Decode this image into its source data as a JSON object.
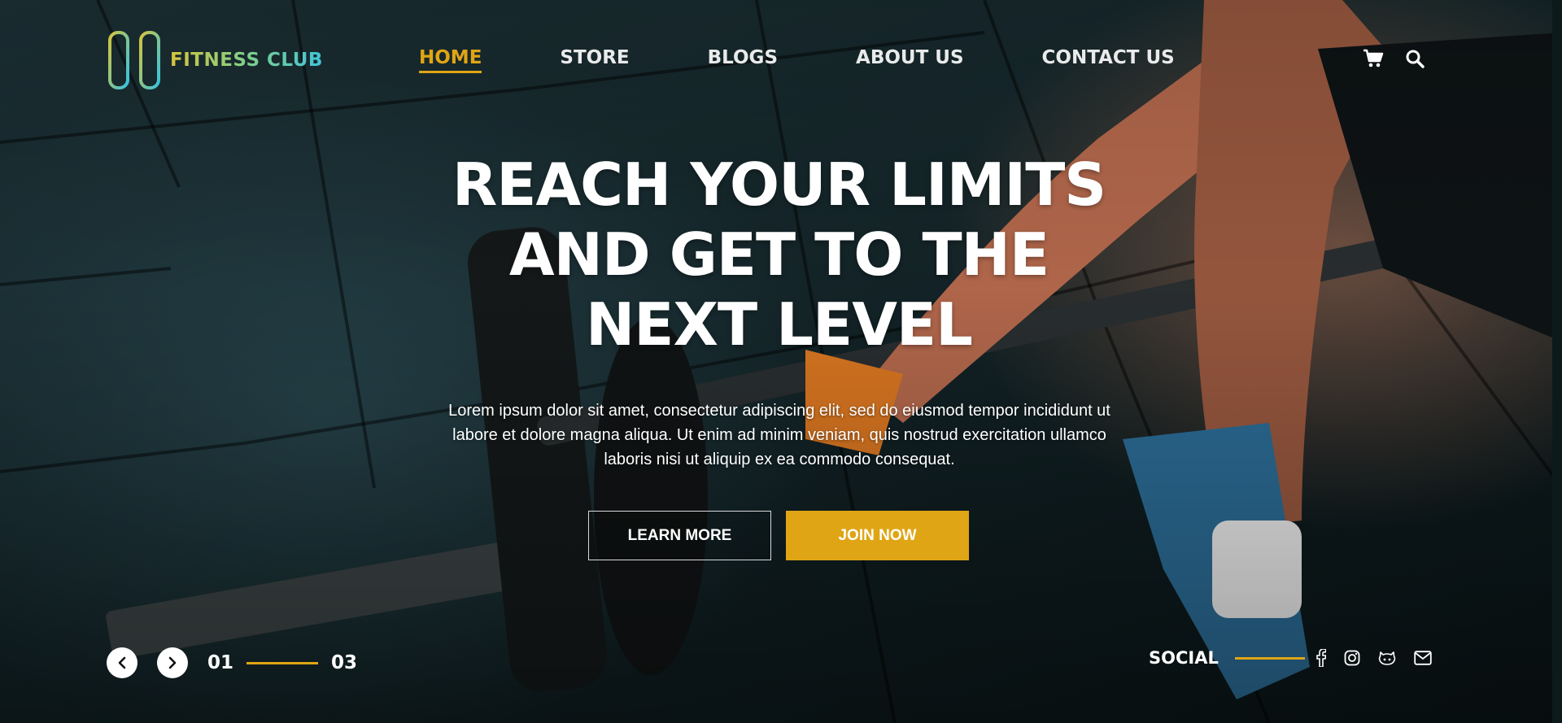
{
  "brand": {
    "name": "FITNESS CLUB"
  },
  "nav": {
    "items": [
      {
        "label": "HOME",
        "active": true
      },
      {
        "label": "STORE",
        "active": false
      },
      {
        "label": "BLOGS",
        "active": false
      },
      {
        "label": "ABOUT US",
        "active": false
      },
      {
        "label": "CONTACT US",
        "active": false
      }
    ],
    "icons": [
      "cart-icon",
      "search-icon"
    ]
  },
  "hero": {
    "headline_lines": [
      "REACH YOUR LIMITS",
      "AND GET TO THE",
      "NEXT LEVEL"
    ],
    "lead_lines": [
      "Lorem ipsum dolor sit amet, consectetur adipiscing elit, sed do eiusmod tempor incididunt ut",
      "labore et dolore magna aliqua. Ut enim ad minim veniam, quis nostrud exercitation ullamco",
      "laboris nisi ut aliquip ex ea commodo consequat."
    ],
    "learn_more_label": "LEARN MORE",
    "join_now_label": "JOIN NOW"
  },
  "slider": {
    "current": "01",
    "total": "03",
    "prev_icon": "chevron-left-icon",
    "next_icon": "chevron-right-icon"
  },
  "social": {
    "label": "SOCIAL",
    "icons": [
      "facebook-icon",
      "instagram-icon",
      "github-icon",
      "mail-icon"
    ]
  },
  "colors": {
    "accent": "#e0a514",
    "text": "#ffffff"
  }
}
